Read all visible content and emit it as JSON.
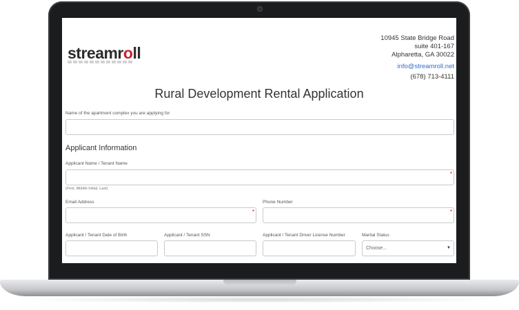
{
  "header": {
    "logo_text_main": "streamr",
    "logo_text_pin": "o",
    "logo_text_end": "ll",
    "address_line1": "10945 State Bridge Road",
    "address_line2": "suite 401-167",
    "address_line3": "Alpharetta, GA 30022",
    "email": "info@streamroll.net",
    "phone": "(678) 713-4111"
  },
  "form": {
    "title": "Rural Development Rental Application",
    "complex_label": "Name of the apartment complex you are applying for",
    "section_title": "Applicant Information",
    "applicant_name_label": "Applicant Name / Tenant Name",
    "applicant_name_hint": "(First, Middle Initial, Last)",
    "email_label": "Email Address",
    "phone_label": "Phone Number",
    "dob_label": "Applicant / Tenant Date of Birth",
    "ssn_label": "Applicant / Tenant SSN",
    "license_label": "Applicant / Tenant Driver License Number",
    "marital_label": "Marital Status",
    "marital_value": "Choose...",
    "required_marker": "*"
  }
}
